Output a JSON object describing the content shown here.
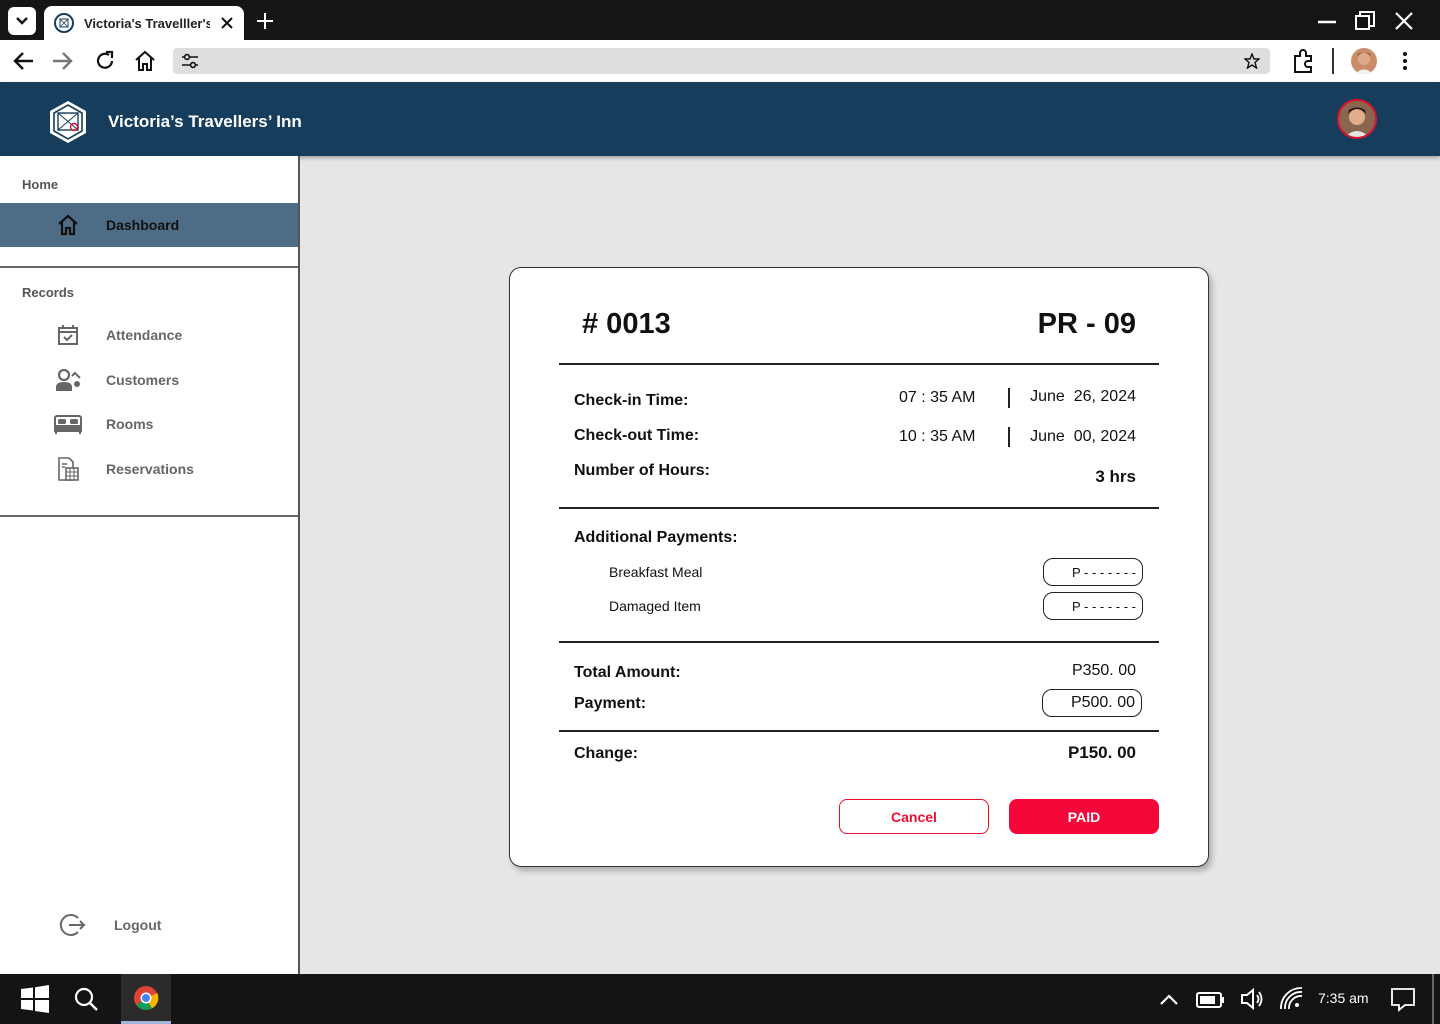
{
  "browser": {
    "tab_title": "Victoria's Travelller's"
  },
  "header": {
    "brand": "Victoria’s Travellers’ Inn"
  },
  "sidebar": {
    "home_label": "Home",
    "records_label": "Records",
    "items": [
      {
        "label": "Dashboard",
        "icon": "home-icon",
        "active": true
      },
      {
        "label": "Attendance",
        "icon": "calendar-check-icon"
      },
      {
        "label": "Customers",
        "icon": "customers-icon"
      },
      {
        "label": "Rooms",
        "icon": "bed-icon"
      },
      {
        "label": "Reservations",
        "icon": "reservations-icon"
      }
    ],
    "logout_label": "Logout"
  },
  "receipt": {
    "number": "# 0013",
    "room": "PR - 09",
    "checkin_label": "Check-in Time:",
    "checkin_time": "07 : 35 AM",
    "checkin_date": "June  26, 2024",
    "checkout_label": "Check-out Time:",
    "checkout_time": "10 : 35 AM",
    "checkout_date": "June  00, 2024",
    "hours_label": "Number of Hours:",
    "hours_value": "3 hrs",
    "additional_label": "Additional Payments:",
    "breakfast_label": "Breakfast Meal",
    "breakfast_value": "P - - - - - - -",
    "damaged_label": "Damaged Item",
    "damaged_value": "P - - - - - - -",
    "total_label": "Total Amount:",
    "total_value": "P350. 00",
    "payment_label": "Payment:",
    "payment_value": "P500. 00",
    "change_label": "Change:",
    "change_value": "P150. 00",
    "cancel_label": "Cancel",
    "paid_label": "PAID"
  },
  "taskbar": {
    "clock": "7:35 am"
  },
  "colors": {
    "header_bg": "#163e5c",
    "active_nav": "#4e6c86",
    "accent_red": "#f5073a"
  }
}
